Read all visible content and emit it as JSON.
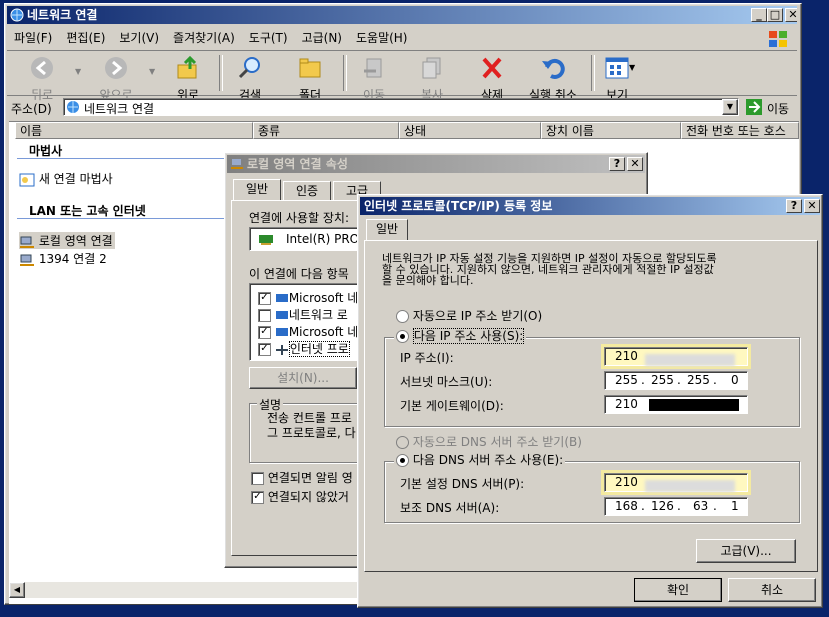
{
  "explorer": {
    "title": "네트워크 연결",
    "menu": [
      "파일(F)",
      "편집(E)",
      "보기(V)",
      "즐겨찾기(A)",
      "도구(T)",
      "고급(N)",
      "도움말(H)"
    ],
    "toolbar": {
      "back": "뒤로",
      "forward": "앞으로",
      "up": "위로",
      "search": "검색",
      "folders": "폴더",
      "move": "이동",
      "copy": "복사",
      "delete": "삭제",
      "undo": "실행 취소",
      "view": "보기"
    },
    "address_label": "주소(D)",
    "address_value": "네트워크 연결",
    "go_label": "이동",
    "columns": [
      "이름",
      "종류",
      "상태",
      "장치 이름",
      "전화 번호 또는 호스"
    ],
    "groups": [
      {
        "label": "마법사",
        "items": [
          "새 연결 마법사"
        ]
      },
      {
        "label": "LAN 또는 고속 인터넷",
        "items": [
          "로컬 영역 연결",
          "1394 연결 2"
        ]
      }
    ]
  },
  "lan_props": {
    "title": "로컬 영역 연결 속성",
    "tabs": [
      "일반",
      "인증",
      "고급"
    ],
    "connect_using_label": "연결에 사용할 장치:",
    "adapter": "Intel(R) PRO",
    "components_label": "이 연결에 다음 항목",
    "components": [
      {
        "label": "Microsoft 네",
        "checked": true
      },
      {
        "label": "네트워크 로",
        "checked": false
      },
      {
        "label": "Microsoft 네",
        "checked": true
      },
      {
        "label": "인터넷 프로",
        "checked": true
      }
    ],
    "install_button": "설치(N)...",
    "description_label": "설명",
    "description_text": "전송 컨트롤 프로\n그 프로토콜로, 다",
    "notify_label": "연결되면 알림 영",
    "notify_checked": false,
    "limited_label": "연결되지 않았거",
    "limited_checked": true
  },
  "tcpip": {
    "title": "인터넷 프로토콜(TCP/IP) 등록 정보",
    "tab": "일반",
    "intro": "네트워크가 IP 자동 설정 기능을 지원하면 IP 설정이 자동으로 할당되도록\n할 수 있습니다. 지원하지 않으면, 네트워크 관리자에게 적절한 IP 설정값\n을 문의해야 합니다.",
    "auto_ip_label": "자동으로 IP 주소 받기(O)",
    "manual_ip_label": "다음 IP 주소 사용(S):",
    "ip_label": "IP 주소(I):",
    "ip_value": "210",
    "subnet_label": "서브넷 마스크(U):",
    "subnet_value": [
      "255",
      "255",
      "255",
      "0"
    ],
    "gateway_label": "기본 게이트웨이(D):",
    "gateway_value": "210",
    "auto_dns_label": "자동으로 DNS 서버 주소 받기(B)",
    "manual_dns_label": "다음 DNS 서버 주소 사용(E):",
    "pref_dns_label": "기본 설정 DNS 서버(P):",
    "pref_dns_value": "210",
    "alt_dns_label": "보조 DNS 서버(A):",
    "alt_dns_value": [
      "168",
      "126",
      "63",
      "1"
    ],
    "advanced_button": "고급(V)...",
    "ok_button": "확인",
    "cancel_button": "취소"
  },
  "colors": {
    "title_active": "#0a246a",
    "title_gradient_end": "#a6caf0",
    "face": "#d4d0c8",
    "highlight_yellow": "#fff8c0"
  }
}
